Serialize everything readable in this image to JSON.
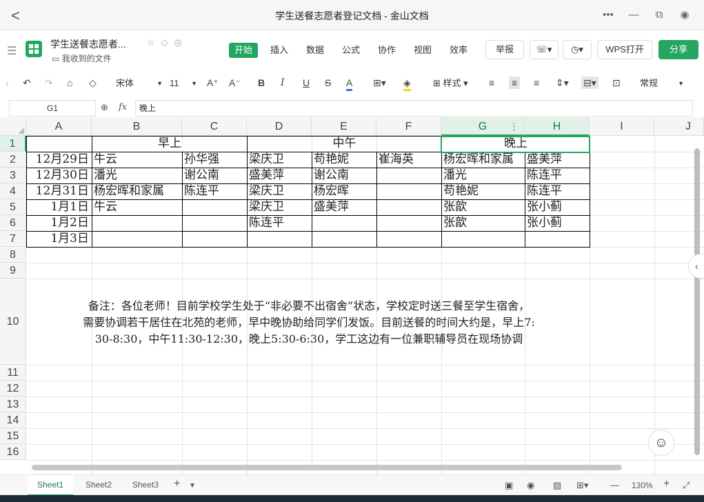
{
  "window": {
    "title": "学生送餐志愿者登记文档 - 金山文档",
    "back": "<",
    "more": "•••",
    "minimize": "—",
    "restore": "⧉",
    "close": "◉"
  },
  "doc": {
    "name": "学生送餐志愿者...",
    "folder": "我收到的文件"
  },
  "tabs": [
    "开始",
    "插入",
    "数据",
    "公式",
    "协作",
    "视图",
    "效率"
  ],
  "header_buttons": {
    "report": "举报",
    "wps_open": "WPS打开",
    "share": "分享"
  },
  "toolbar": {
    "font": "宋体",
    "size": "11",
    "style": "样式",
    "format": "常规"
  },
  "formula_bar": {
    "cell_ref": "G1",
    "fx": "fx",
    "value": "晚上"
  },
  "columns": [
    "A",
    "B",
    "C",
    "D",
    "E",
    "F",
    "G",
    "H",
    "I",
    "J"
  ],
  "rows": [
    "1",
    "2",
    "3",
    "4",
    "5",
    "6",
    "7",
    "8",
    "9",
    "10",
    "11",
    "12",
    "13",
    "14",
    "15",
    "16"
  ],
  "table": {
    "headers": {
      "morning": "早上",
      "noon": "中午",
      "evening": "晚上"
    },
    "data": [
      [
        "12月29日",
        "牛云",
        "孙华强",
        "梁庆卫",
        "苟艳妮",
        "崔海英",
        "杨宏晖和家属",
        "盛美萍"
      ],
      [
        "12月30日",
        "潘光",
        "谢公南",
        "盛美萍",
        "谢公南",
        "",
        "潘光",
        "陈连平"
      ],
      [
        "12月31日",
        "杨宏晖和家属",
        "陈连平",
        "梁庆卫",
        "杨宏晖",
        "",
        "苟艳妮",
        "陈连平"
      ],
      [
        "1月1日",
        "牛云",
        "",
        "梁庆卫",
        "盛美萍",
        "",
        "张歆",
        "张小蓟"
      ],
      [
        "1月2日",
        "",
        "",
        "陈连平",
        "",
        "",
        "张歆",
        "张小蓟"
      ],
      [
        "1月3日",
        "",
        "",
        "",
        "",
        "",
        "",
        ""
      ]
    ]
  },
  "note": "备注：各位老师！目前学校学生处于“非必要不出宿舍”状态，学校定时送三餐至学生宿舍，\n需要协调若干居住在北苑的老师，早中晚协助给同学们发饭。目前送餐的时间大约是，早上7:\n30-8:30，中午11:30-12:30，晚上5:30-6:30，学工这边有一位兼职辅导员在现场协调",
  "sheets": [
    "Sheet1",
    "Sheet2",
    "Sheet3"
  ],
  "status": {
    "zoom": "130%",
    "minus": "—",
    "plus": "+"
  }
}
